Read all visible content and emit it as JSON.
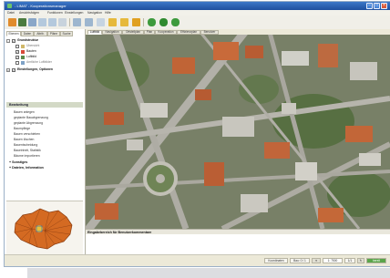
{
  "window": {
    "title": "- LIMAT - Kooperationsmanager"
  },
  "menu": [
    "Datei",
    "Ansichtsfolgen",
    "Funktionen",
    "Einstellungen",
    "Navigation",
    "Hilfe"
  ],
  "toolbar_icons": [
    "home-icon",
    "save-icon",
    "print-icon",
    "undo-icon",
    "redo-icon",
    "tools-icon",
    "layers-icon",
    "settings-icon",
    "folder-open-icon",
    "folder-icon",
    "star-icon",
    "tree-icon",
    "tree-icon",
    "tree-icon"
  ],
  "left_tabs": [
    "Ebenen",
    "Daten",
    "Attrib.",
    "Pläne",
    "Suche"
  ],
  "tree": {
    "group1": "Grundstruktur",
    "items": [
      "Übersicht",
      "Bauten",
      "Luftbild",
      "Amtliche Luftbilder"
    ],
    "group2": "Einstellungen, Optionen"
  },
  "tasks": {
    "header": "Bearbeitung",
    "items": [
      "Bauen anlegen",
      "geplante Bauabgrenzung",
      "geplante Abgrenzung",
      "Baumpflege",
      "Bauen verschieben",
      "Bauen löschen",
      "Bauentscheidung",
      "Baueinheit, Statistik",
      "Bäume importieren"
    ],
    "sub1": "Sonstiges",
    "sub2": "Dateien, Information"
  },
  "main_tabs": [
    "Luftbild",
    "Navigation",
    "Ortsteilplan",
    "Plan",
    "Kooperation",
    "Effizienzplan",
    "Benutzer"
  ],
  "info_title": "Eingabebereich für Benutzerkommentare",
  "status": {
    "field1": "Koordinaten",
    "field2": "Bau: 0 / 1",
    "scale": "1: 7500",
    "page": "1/1",
    "ready": "bereit"
  },
  "colors": {
    "titlebar": "#1e4f9e",
    "task_header": "#d3d9c6",
    "city_map": "#d46a22"
  }
}
